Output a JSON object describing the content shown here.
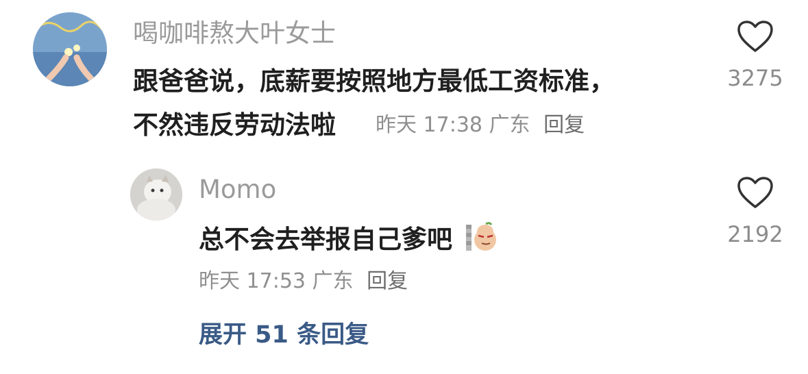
{
  "comments": [
    {
      "username": "喝咖啡熬大叶女士",
      "text_line1": "跟爸爸说，底薪要按照地方最低工资标准，",
      "text_line2": "不然违反劳动法啦",
      "time": "昨天 17:38",
      "location": "广东",
      "reply_label": "回复",
      "likes": "3275"
    },
    {
      "username": "Momo",
      "text": "总不会去举报自己爹吧",
      "time": "昨天 17:53",
      "location": "广东",
      "reply_label": "回复",
      "likes": "2192"
    }
  ],
  "expand_label": "展开 51 条回复",
  "icons": {
    "like": "heart-outline-icon",
    "sticker": "peanut-sticker-icon"
  },
  "colors": {
    "username": "#9a9a9a",
    "text": "#1f1f1f",
    "meta": "#8f8f8f",
    "expand": "#3a5a86"
  }
}
